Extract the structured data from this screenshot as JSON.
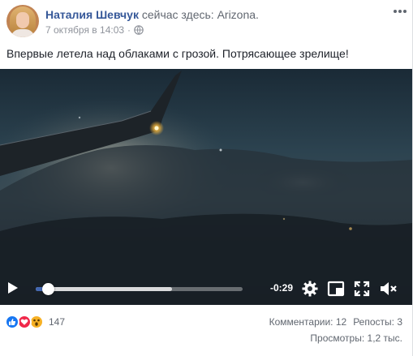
{
  "post": {
    "author": "Наталия Шевчук",
    "activity": "сейчас здесь:",
    "place": "Arizona.",
    "timestamp": "7 октября в 14:03",
    "separator": "·",
    "text": "Впервые летела над облаками с грозой. Потрясающее зрелище!",
    "more_icon": "ellipsis-icon",
    "privacy_icon": "globe-icon"
  },
  "video": {
    "time_remaining": "-0:29",
    "progress": 0.06,
    "buffered": 0.66,
    "controls": [
      "play-icon",
      "gear-icon",
      "picture-in-picture-icon",
      "fullscreen-icon",
      "volume-muted-icon"
    ]
  },
  "footer": {
    "reactions": [
      "like-icon",
      "love-icon",
      "wow-icon"
    ],
    "reaction_count": "147",
    "comments": "Комментарии: 12",
    "shares": "Репосты: 3",
    "views": "Просмотры: 1,2 тыс."
  },
  "colors": {
    "link": "#365899",
    "accent": "#4267b2",
    "muted": "#616770"
  }
}
